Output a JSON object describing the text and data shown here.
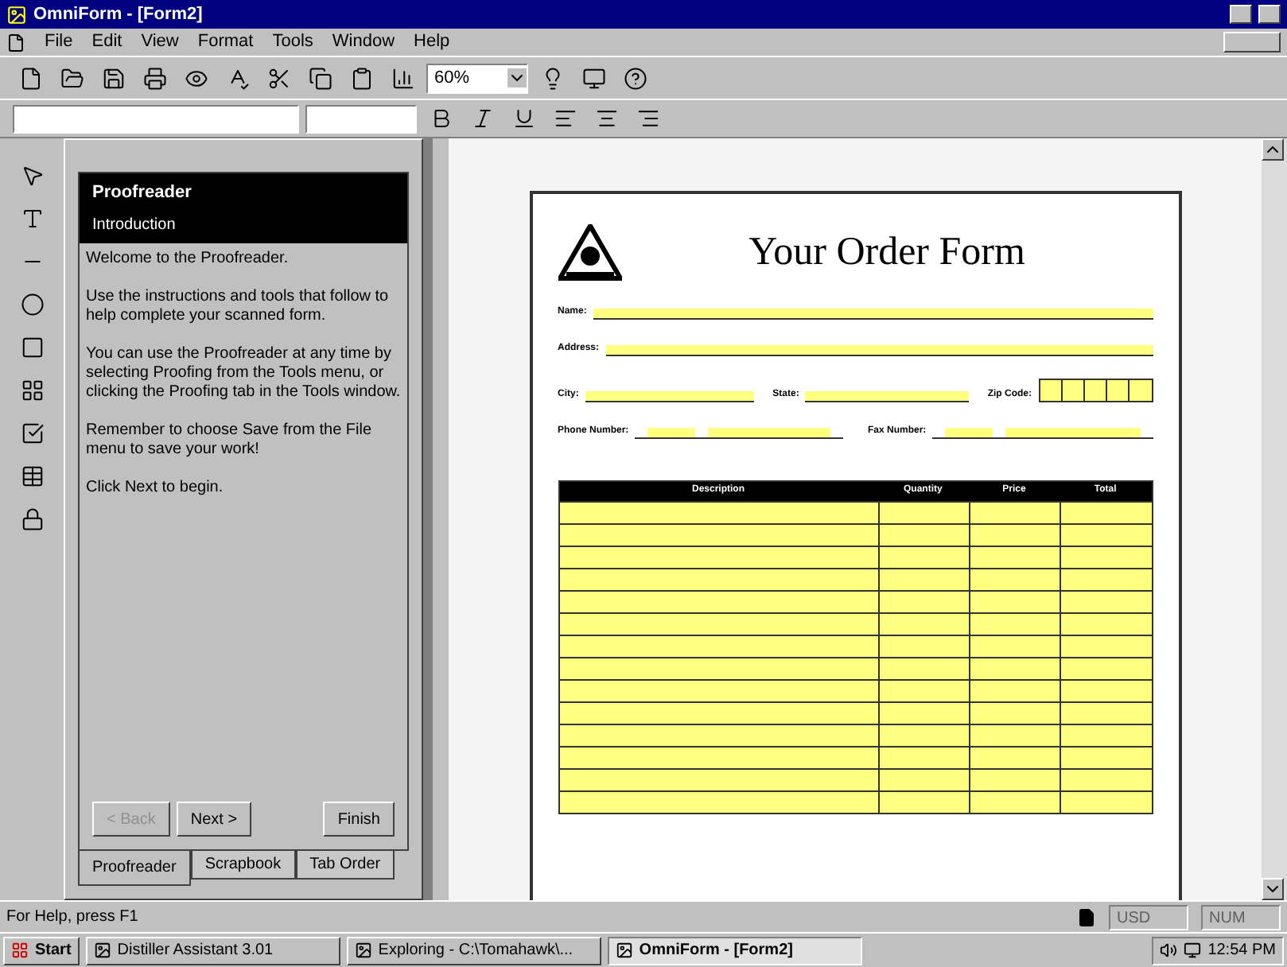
{
  "window": {
    "title": "OmniForm - [Form2]"
  },
  "menu": [
    "File",
    "Edit",
    "View",
    "Format",
    "Tools",
    "Window",
    "Help"
  ],
  "toolbar": {
    "zoom": "60%"
  },
  "proofreader": {
    "title": "Proofreader",
    "subtitle": "Introduction",
    "paragraphs": [
      "Welcome to the Proofreader.",
      "Use the instructions and tools that follow to help complete your scanned form.",
      "You can use the Proofreader at any time by selecting Proofing from the Tools menu, or clicking the Proofing tab in the Tools window.",
      "Remember to choose Save from the File menu to save your work!",
      "Click Next to begin."
    ],
    "buttons": [
      {
        "label": "< Back",
        "disabled": true
      },
      {
        "label": "Next >",
        "disabled": false
      },
      {
        "label": "Finish",
        "disabled": false
      }
    ],
    "tabs": [
      {
        "label": "Proofreader",
        "selected": true
      },
      {
        "label": "Scrapbook",
        "selected": false
      },
      {
        "label": "Tab Order",
        "selected": false
      }
    ]
  },
  "form": {
    "title": "Your Order Form",
    "fields": [
      {
        "label": "Name:",
        "kind": "line"
      },
      {
        "label": "Address:",
        "kind": "line"
      }
    ],
    "row3": [
      {
        "label": "City:",
        "kind": "line"
      },
      {
        "label": "State:",
        "kind": "line"
      },
      {
        "label": "Zip Code:",
        "kind": "boxes"
      }
    ],
    "row4": [
      {
        "label": "Phone Number:",
        "kind": "phone"
      },
      {
        "label": "Fax Number:",
        "kind": "phone"
      }
    ],
    "table": {
      "columns": [
        "Description",
        "Quantity",
        "Price",
        "Total"
      ]
    }
  },
  "status_bar": {
    "text": "For Help, press F1",
    "indicators": [
      "USD",
      "NUM"
    ]
  },
  "taskbar": {
    "start": "Start",
    "items": [
      {
        "label": "Distiller Assistant 3.01",
        "selected": false
      },
      {
        "label": "Exploring - C:\\Tomahawk\\...",
        "selected": false
      },
      {
        "label": "OmniForm - [Form2]",
        "selected": true
      }
    ],
    "clock": "12:54 PM"
  }
}
